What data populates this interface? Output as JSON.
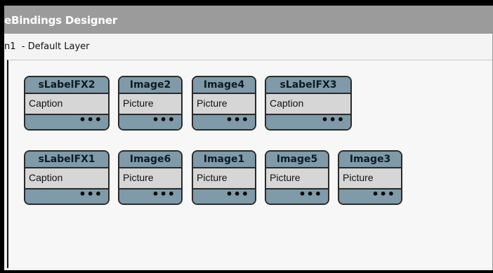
{
  "window": {
    "title": "eBindings Designer",
    "layer_label": "n1  - Default Layer"
  },
  "bindings": [
    {
      "name": "sLabelFX2",
      "property": "Caption",
      "more": "•••"
    },
    {
      "name": "Image2",
      "property": "Picture",
      "more": "•••"
    },
    {
      "name": "Image4",
      "property": "Picture",
      "more": "•••"
    },
    {
      "name": "sLabelFX3",
      "property": "Caption",
      "more": "•••"
    },
    {
      "name": "sLabelFX1",
      "property": "Caption",
      "more": "•••"
    },
    {
      "name": "Image6",
      "property": "Picture",
      "more": "•••"
    },
    {
      "name": "Image1",
      "property": "Picture",
      "more": "•••"
    },
    {
      "name": "Image5",
      "property": "Picture",
      "more": "•••"
    },
    {
      "name": "Image3",
      "property": "Picture",
      "more": "•••"
    }
  ],
  "colors": {
    "header": "#7f9aa8",
    "body": "#d6d6d6",
    "title_bar": "#9b9b9b"
  }
}
